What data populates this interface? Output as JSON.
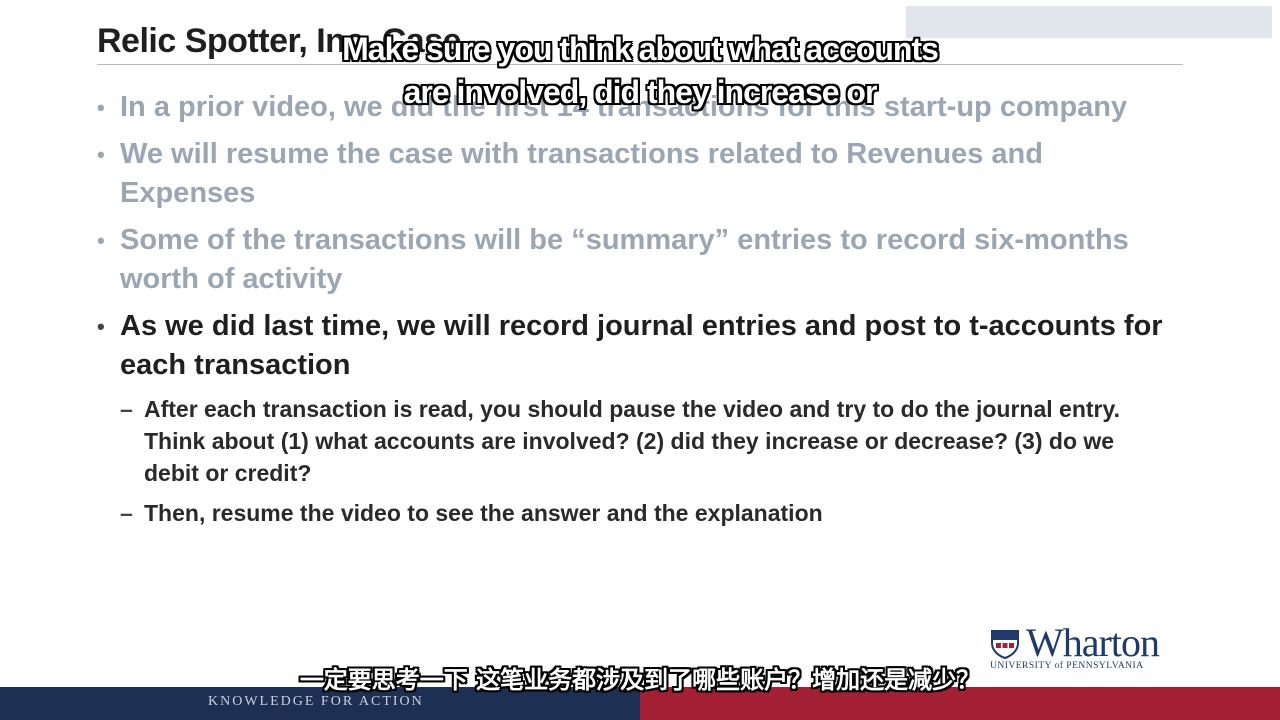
{
  "slide": {
    "title": "Relic Spotter, Inc. Case",
    "bullets": [
      "In a prior video, we did the first 14 transactions for this start-up company",
      "We will resume the case with transactions related to Revenues and Expenses",
      "Some of the transactions will be “summary” entries to record six-months worth of activity",
      "As we did last time, we will record journal entries and post to t-accounts for each transaction"
    ],
    "sub_bullets": [
      "After each transaction is read, you should pause the video and try to do the journal entry.  Think about (1) what accounts are involved? (2) did they increase or decrease? (3) do we debit or credit?",
      "Then, resume the video to see the answer and the explanation"
    ],
    "bullet_marker": "•",
    "sub_marker": "–"
  },
  "logo": {
    "wordmark": "Wharton",
    "subline": "UNIVERSITY of PENNSYLVANIA"
  },
  "footer": {
    "tagline": "KNOWLEDGE FOR ACTION"
  },
  "subtitles": {
    "english_line1": "Make sure you think about what accounts",
    "english_line2": "are involved, did they increase or",
    "chinese": "一定要思考一下 这笔业务都涉及到了哪些账户？增加还是减少？"
  },
  "colors": {
    "footer_navy": "#1d2f52",
    "footer_red": "#a31f34",
    "brand_blue": "#1f3a6b",
    "inactive_text": "#9aa6b3"
  }
}
